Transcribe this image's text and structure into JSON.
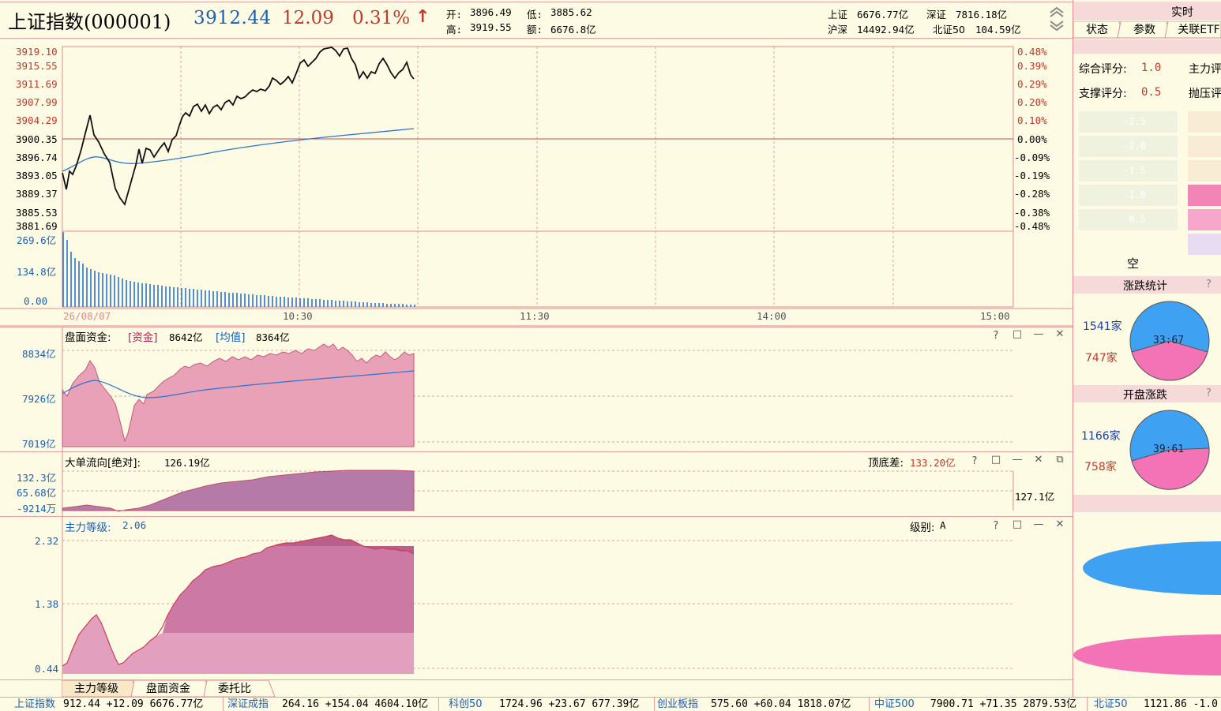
{
  "header": {
    "title": "上证指数(000001)",
    "price": "3912.44",
    "change": "12.09",
    "change_pct": "0.31%",
    "arrow": "↑",
    "open_label": "开:",
    "open": "3896.49",
    "low_label": "低:",
    "low": "3885.62",
    "high_label": "高:",
    "high": "3919.55",
    "amount_label": "额:",
    "amount": "6676.8亿",
    "sh_label": "上证",
    "sh": "6676.77亿",
    "sz_label": "深证",
    "sz": "7816.18亿",
    "hs_label": "沪深",
    "hs": "14492.94亿",
    "bz_label": "北证50",
    "bz": "104.59亿"
  },
  "price_chart": {
    "left_ticks": [
      "3919.10",
      "3915.55",
      "3911.69",
      "3907.99",
      "3904.29",
      "3900.35",
      "3896.74",
      "3893.05",
      "3889.37",
      "3885.53",
      "3881.69"
    ],
    "right_ticks": [
      "0.48%",
      "0.39%",
      "0.29%",
      "0.20%",
      "0.10%",
      "0.00%",
      "-0.09%",
      "-0.19%",
      "-0.28%",
      "-0.38%",
      "-0.48%"
    ],
    "volume_ticks": [
      "269.6亿",
      "134.8亿",
      "0.00"
    ],
    "time_labels": [
      "26/08/07",
      "10:30",
      "11:30",
      "14:00",
      "15:00"
    ]
  },
  "panel_funds": {
    "title": "盘面资金:",
    "fund_label": "[资金]",
    "fund_value": "8642亿",
    "avg_label": "[均值]",
    "avg_value": "8364亿",
    "ticks": [
      "8834亿",
      "7926亿",
      "7019亿"
    ]
  },
  "panel_bigorder": {
    "title": "大单流向[绝对]:",
    "value": "126.19亿",
    "diff_label": "顶底差:",
    "diff_value": "133.20亿",
    "ticks": [
      "132.3亿",
      "65.68亿",
      "-9214万"
    ],
    "side_value": "127.1亿"
  },
  "panel_level": {
    "title": "主力等级:",
    "value": "2.06",
    "grade_label": "级别:",
    "grade_value": "A",
    "ticks": [
      "2.32",
      "1.38",
      "0.44"
    ]
  },
  "bottom_tabs": [
    "主力等级",
    "盘面资金",
    "委托比"
  ],
  "ticker": [
    {
      "name": "上证指数",
      "data": "912.44  +12.09  6676.77亿"
    },
    {
      "name": "深证成指",
      "data": "264.16  +154.04  4604.10亿"
    },
    {
      "name": "科创50",
      "data": "1724.96  +23.67  677.39亿"
    },
    {
      "name": "创业板指",
      "data": "575.60  +60.04  1818.07亿"
    },
    {
      "name": "中证500",
      "data": "7900.71  +71.35  2879.53亿"
    },
    {
      "name": "北证50",
      "data": "1121.86  -1.0"
    }
  ],
  "sidebar": {
    "realtime_label": "实时",
    "tabs": [
      "状态",
      "参数",
      "关联ETF"
    ],
    "score1_label": "综合评分:",
    "score1": "1.0",
    "score1_right": "主力评",
    "score2_label": "支撑评分:",
    "score2": "0.5",
    "score2_right": "抛压评",
    "grid_labels": [
      "-2.5",
      "-2.0",
      "-1.5",
      "-1.0",
      "-0.5"
    ],
    "empty_label": "空",
    "stats_title": "涨跌统计",
    "stats_up": "1541家",
    "stats_down": "747家",
    "stats_ratio": "33:67",
    "open_title": "开盘涨跌",
    "open_up": "1166家",
    "open_down": "758家",
    "open_ratio": "39:61",
    "help": "?"
  },
  "colors": {
    "red": "#c0392b",
    "blue": "#1a5fb4",
    "pink_area": "#e8a1b6",
    "purple_area": "#b57aa8",
    "pie_blue": "#3ea1f2",
    "pie_pink": "#f472b6"
  }
}
